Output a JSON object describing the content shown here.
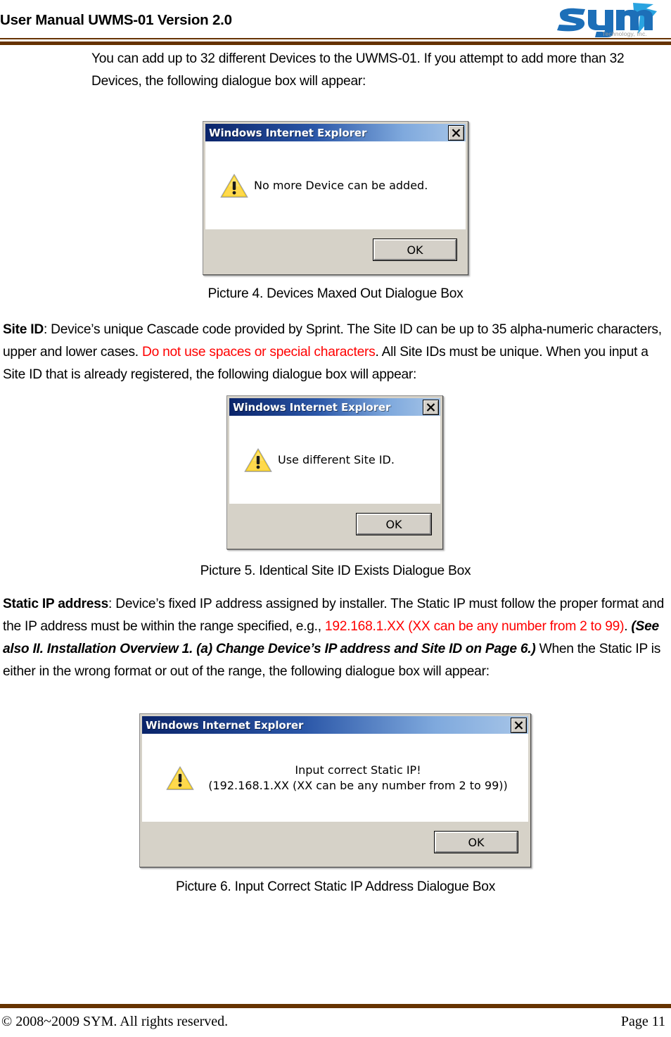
{
  "header": {
    "title": "User Manual UWMS-01 Version 2.0",
    "logo_text": "sym",
    "logo_tagline": "Technology, Inc.",
    "rule_color": "#663300"
  },
  "content": {
    "intro_paragraph": "You can add up to 32 different Devices to the UWMS-01.  If you attempt to add more than 32 Devices, the following dialogue box will appear:",
    "caption_4": "Picture  4. Devices Maxed Out Dialogue Box",
    "site_id": {
      "label": "Site ID",
      "text_1": ": Device’s unique Cascade code provided by Sprint.  The Site ID can be up to 35 alpha-numeric characters, upper and lower cases.  ",
      "warning": "Do not use spaces or special characters",
      "text_2": ".  All Site IDs must be unique. When you input a Site ID that is already registered, the following dialogue box will appear:"
    },
    "caption_5": "Picture  5. Identical Site ID Exists Dialogue Box",
    "static_ip": {
      "label": "Static IP address",
      "text_1": ": Device’s fixed IP address assigned by installer.  The Static IP must follow the proper format and the IP address must be within the range specified, e.g., ",
      "highlight": "192.168.1.XX   (XX can be any number from 2 to 99)",
      "text_2": ".  ",
      "reference": "(See also II. Installation Overview 1. (a) Change Device’s IP address and Site ID on Page 6.)",
      "text_3": "   When the Static IP is either in the wrong format or out of the range, the following dialogue box will appear:"
    },
    "caption_6": "Picture  6. Input Correct Static IP Address Dialogue Box",
    "warning_text_color": "#ff0000"
  },
  "dialogs": [
    {
      "title": "Windows Internet Explorer",
      "message": "No more Device can be added.",
      "button_label": "OK",
      "icon": "warning-triangle-icon",
      "close_label": "Close"
    },
    {
      "title": "Windows Internet Explorer",
      "message": "Use different Site ID.",
      "button_label": "OK",
      "icon": "warning-triangle-icon",
      "close_label": "Close"
    },
    {
      "title": "Windows Internet Explorer",
      "message": "Input correct Static IP!\n(192.168.1.XX (XX can be any number from 2 to 99))",
      "button_label": "OK",
      "icon": "warning-triangle-icon",
      "close_label": "Close"
    }
  ],
  "footer": {
    "copyright": "© 2008~2009 SYM.  All rights reserved.",
    "page_number": "Page 11"
  }
}
